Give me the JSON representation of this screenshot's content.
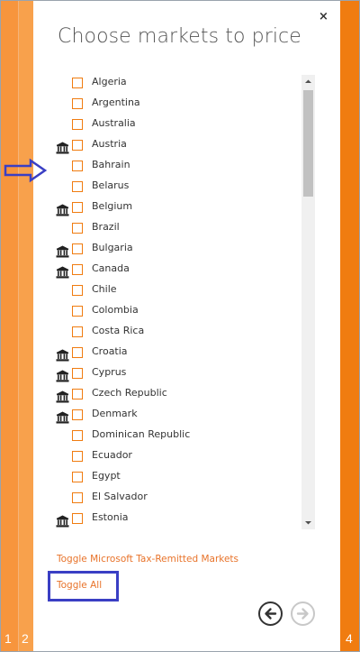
{
  "dialog": {
    "title": "Choose markets to price",
    "close_glyph": "×"
  },
  "markets": [
    {
      "name": "Algeria",
      "tax_remitted": false,
      "checked": false
    },
    {
      "name": "Argentina",
      "tax_remitted": false,
      "checked": false
    },
    {
      "name": "Australia",
      "tax_remitted": false,
      "checked": false
    },
    {
      "name": "Austria",
      "tax_remitted": true,
      "checked": false
    },
    {
      "name": "Bahrain",
      "tax_remitted": false,
      "checked": false
    },
    {
      "name": "Belarus",
      "tax_remitted": false,
      "checked": false
    },
    {
      "name": "Belgium",
      "tax_remitted": true,
      "checked": false
    },
    {
      "name": "Brazil",
      "tax_remitted": false,
      "checked": false
    },
    {
      "name": "Bulgaria",
      "tax_remitted": true,
      "checked": false
    },
    {
      "name": "Canada",
      "tax_remitted": true,
      "checked": false
    },
    {
      "name": "Chile",
      "tax_remitted": false,
      "checked": false
    },
    {
      "name": "Colombia",
      "tax_remitted": false,
      "checked": false
    },
    {
      "name": "Costa Rica",
      "tax_remitted": false,
      "checked": false
    },
    {
      "name": "Croatia",
      "tax_remitted": true,
      "checked": false
    },
    {
      "name": "Cyprus",
      "tax_remitted": true,
      "checked": false
    },
    {
      "name": "Czech Republic",
      "tax_remitted": true,
      "checked": false
    },
    {
      "name": "Denmark",
      "tax_remitted": true,
      "checked": false
    },
    {
      "name": "Dominican Republic",
      "tax_remitted": false,
      "checked": false
    },
    {
      "name": "Ecuador",
      "tax_remitted": false,
      "checked": false
    },
    {
      "name": "Egypt",
      "tax_remitted": false,
      "checked": false
    },
    {
      "name": "El Salvador",
      "tax_remitted": false,
      "checked": false
    },
    {
      "name": "Estonia",
      "tax_remitted": true,
      "checked": false
    }
  ],
  "links": {
    "toggle_tax_remitted": "Toggle Microsoft Tax-Remitted Markets",
    "toggle_all": "Toggle All"
  },
  "icons": {
    "tax_remitted": "bank-icon",
    "prev": "arrow-left-icon",
    "next": "arrow-right-icon",
    "annotation": "arrow-right-outline-icon"
  },
  "rails": {
    "left_a": "1",
    "left_b": "2",
    "right": "4"
  },
  "colors": {
    "accent": "#f07c10",
    "link": "#e8732a",
    "annotation": "#3a3fc4"
  }
}
